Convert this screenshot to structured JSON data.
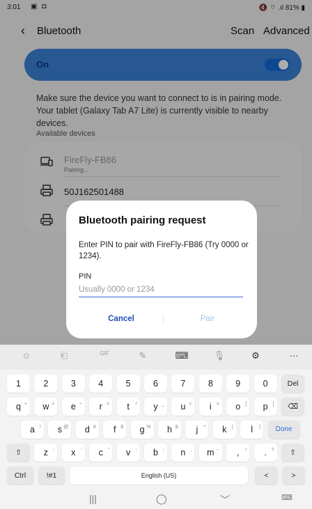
{
  "status_bar": {
    "time": "3:01",
    "icons": "▣ ◘",
    "right": "🔇 ⌔ .ıl 81% ▮"
  },
  "header": {
    "title": "Bluetooth",
    "scan": "Scan",
    "advanced": "Advanced"
  },
  "toggle": {
    "label": "On",
    "state": "on"
  },
  "description": "Make sure the device you want to connect to is in pairing mode. Your tablet (Galaxy Tab A7 Lite) is currently visible to nearby devices.",
  "available_title": "Available devices",
  "devices": [
    {
      "name": "FireFly-FB86",
      "status": "Pairing...",
      "icon": "tablet-laptop-icon"
    },
    {
      "name": "50J162501488",
      "status": "",
      "icon": "printer-icon"
    },
    {
      "name": "",
      "status": "",
      "icon": "printer-icon"
    }
  ],
  "dialog": {
    "title": "Bluetooth pairing request",
    "message": "Enter PIN to pair with FireFly-FB86 (Try 0000 or 1234).",
    "pin_label": "PIN",
    "pin_placeholder": "Usually 0000 or 1234",
    "pin_value": "",
    "cancel": "Cancel",
    "pair": "Pair"
  },
  "keyboard": {
    "toolbar": [
      "☺",
      "⎗",
      "GIF",
      "✎",
      "⌨",
      "🎙",
      "⚙",
      "···"
    ],
    "row1": [
      "1",
      "2",
      "3",
      "4",
      "5",
      "6",
      "7",
      "8",
      "9",
      "0",
      "Del"
    ],
    "row2": [
      {
        "k": "q",
        "s": "+"
      },
      {
        "k": "w",
        "s": "×"
      },
      {
        "k": "e",
        "s": "÷"
      },
      {
        "k": "r",
        "s": "="
      },
      {
        "k": "t",
        "s": "/"
      },
      {
        "k": "y",
        "s": "_"
      },
      {
        "k": "u",
        "s": "<"
      },
      {
        "k": "i",
        "s": ">"
      },
      {
        "k": "o",
        "s": "["
      },
      {
        "k": "p",
        "s": "]"
      },
      {
        "k": "⌫",
        "s": ""
      }
    ],
    "row3": [
      {
        "k": "a",
        "s": "!"
      },
      {
        "k": "s",
        "s": "@"
      },
      {
        "k": "d",
        "s": "#"
      },
      {
        "k": "f",
        "s": "$"
      },
      {
        "k": "g",
        "s": "%"
      },
      {
        "k": "h",
        "s": "&"
      },
      {
        "k": "j",
        "s": "*"
      },
      {
        "k": "k",
        "s": "("
      },
      {
        "k": "l",
        "s": ")"
      },
      {
        "k": "Done",
        "s": ""
      }
    ],
    "row4": [
      {
        "k": "⇧",
        "s": ""
      },
      {
        "k": "z",
        "s": "-"
      },
      {
        "k": "x",
        "s": "'"
      },
      {
        "k": "c",
        "s": "\""
      },
      {
        "k": "v",
        "s": ":"
      },
      {
        "k": "b",
        "s": ";"
      },
      {
        "k": "n",
        "s": ","
      },
      {
        "k": "m",
        "s": "~"
      },
      {
        "k": ",",
        "s": "!"
      },
      {
        "k": ".",
        "s": "?"
      },
      {
        "k": "⇧",
        "s": ""
      }
    ],
    "row5": {
      "ctrl": "Ctrl",
      "sym": "!#1",
      "space": "English (US)",
      "left": "<",
      "right": ">"
    }
  },
  "navbar": {
    "recents": "|||",
    "home": "◯",
    "back": "﹀",
    "kb": "⌨"
  }
}
